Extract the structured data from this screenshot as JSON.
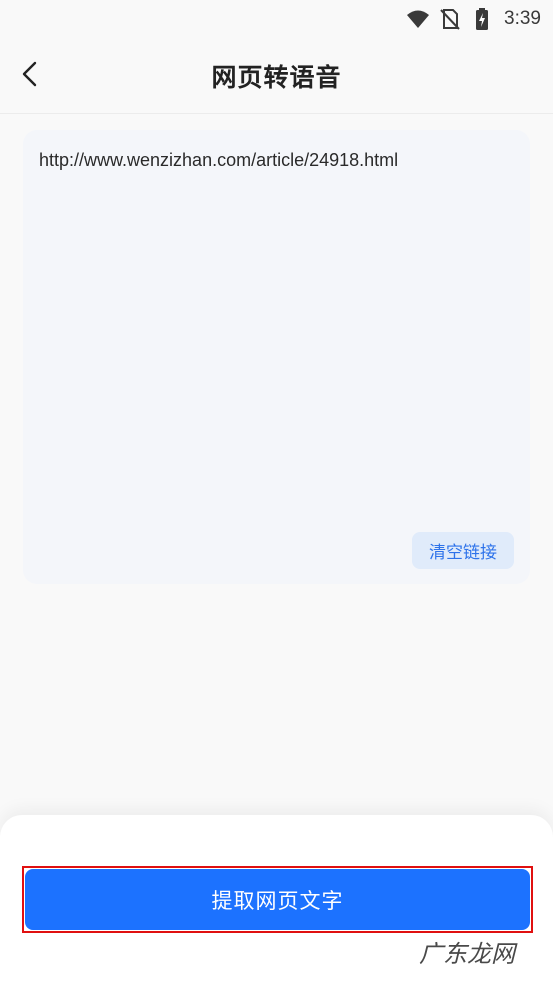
{
  "status_bar": {
    "time": "3:39",
    "icons": [
      "wifi-icon",
      "no-sim-icon",
      "battery-charging-icon"
    ]
  },
  "header": {
    "title": "网页转语音",
    "back_icon": "chevron-left-icon"
  },
  "url_card": {
    "url": "http://www.wenzizhan.com/article/24918.html",
    "clear_label": "清空链接"
  },
  "bottom": {
    "primary_label": "提取网页文字",
    "watermark": "广东龙网"
  },
  "colors": {
    "primary": "#1c72ff",
    "clear_bg": "#e0ebfa",
    "clear_text": "#2e73ea",
    "highlight": "#e01010"
  }
}
